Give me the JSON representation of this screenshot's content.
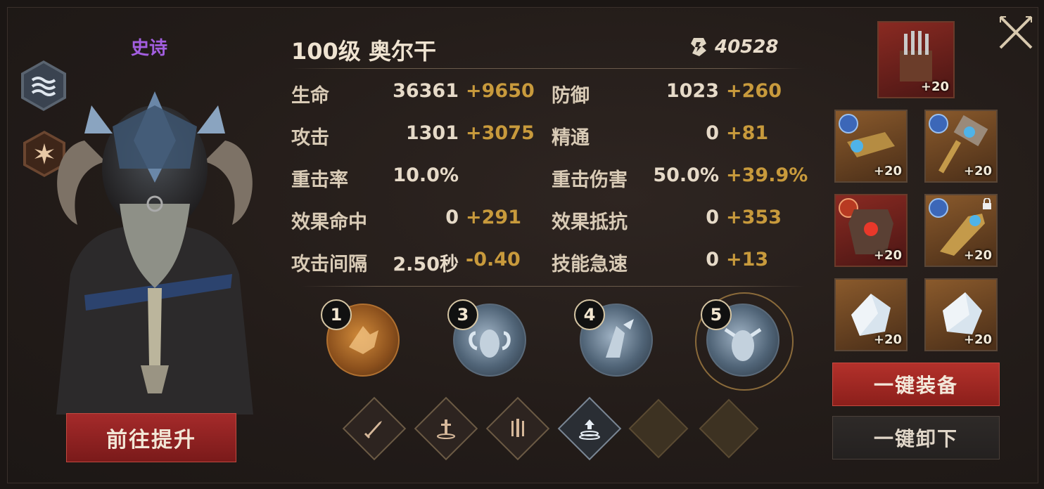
{
  "hero": {
    "rarity": "史诗",
    "title": "100级 奥尔干",
    "power": "40528",
    "goto_button": "前往提升"
  },
  "stats": {
    "left": [
      {
        "label": "生命",
        "base": "36361",
        "bonus": "+9650"
      },
      {
        "label": "攻击",
        "base": "1301",
        "bonus": "+3075"
      },
      {
        "label": "重击率",
        "base": "10.0%",
        "bonus": ""
      },
      {
        "label": "效果命中",
        "base": "0",
        "bonus": "+291"
      },
      {
        "label": "攻击间隔",
        "base": "2.50秒",
        "bonus": "-0.40"
      }
    ],
    "right": [
      {
        "label": "防御",
        "base": "1023",
        "bonus": "+260"
      },
      {
        "label": "精通",
        "base": "0",
        "bonus": "+81"
      },
      {
        "label": "重击伤害",
        "base": "50.0%",
        "bonus": "+39.9%"
      },
      {
        "label": "效果抵抗",
        "base": "0",
        "bonus": "+353"
      },
      {
        "label": "技能急速",
        "base": "0",
        "bonus": "+13"
      }
    ]
  },
  "skills": [
    {
      "number": "1",
      "style": "gold"
    },
    {
      "number": "3",
      "style": "blue"
    },
    {
      "number": "4",
      "style": "blue"
    },
    {
      "number": "5",
      "style": "blue-ringed"
    }
  ],
  "runes": [
    "sword-icon",
    "sword-pedestal-icon",
    "triple-blade-icon",
    "upgrade-arrow-icon",
    "empty",
    "empty"
  ],
  "equipment": {
    "artifact": {
      "level": "+20"
    },
    "slots": [
      {
        "level": "+20",
        "badge": "blue",
        "icon": "bracer-icon"
      },
      {
        "level": "+20",
        "badge": "blue",
        "icon": "hammer-icon"
      },
      {
        "level": "+20",
        "badge": "red",
        "icon": "armor-icon"
      },
      {
        "level": "+20",
        "badge": "blue",
        "icon": "gauntlet-icon",
        "locked": true
      },
      {
        "level": "+20",
        "badge": "",
        "icon": "crystal-icon"
      },
      {
        "level": "+20",
        "badge": "",
        "icon": "crystal-icon"
      }
    ],
    "equip_button": "一键装备",
    "unequip_button": "一键卸下"
  },
  "colors": {
    "rarity": "#a35ee0",
    "bonus": "#c89a3c",
    "primary_button": "#a52a2a"
  }
}
